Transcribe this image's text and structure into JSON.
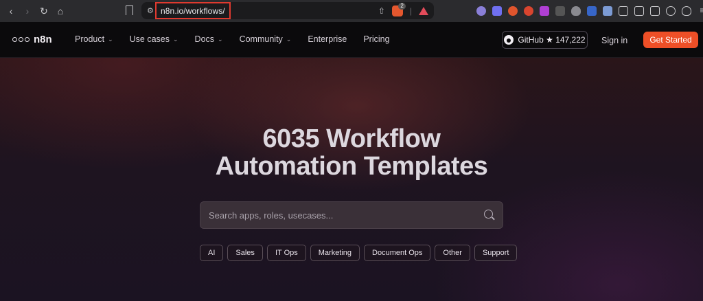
{
  "browser": {
    "url": "n8n.io/workflows/",
    "badge_count": "2"
  },
  "nav": {
    "brand": "n8n",
    "menu": [
      {
        "label": "Product",
        "chevron": true
      },
      {
        "label": "Use cases",
        "chevron": true
      },
      {
        "label": "Docs",
        "chevron": true
      },
      {
        "label": "Community",
        "chevron": true
      },
      {
        "label": "Enterprise",
        "chevron": false
      },
      {
        "label": "Pricing",
        "chevron": false
      }
    ],
    "github_label": "GitHub ★ 147,222",
    "signin": "Sign in",
    "get_started": "Get Started"
  },
  "hero": {
    "title_line1": "6035 Workflow",
    "title_line2": "Automation Templates",
    "search_placeholder": "Search apps, roles, usecases...",
    "categories": [
      "AI",
      "Sales",
      "IT Ops",
      "Marketing",
      "Document Ops",
      "Other",
      "Support"
    ]
  },
  "colors": {
    "accent": "#ee4f27",
    "url_highlight": "#e03a2f"
  }
}
